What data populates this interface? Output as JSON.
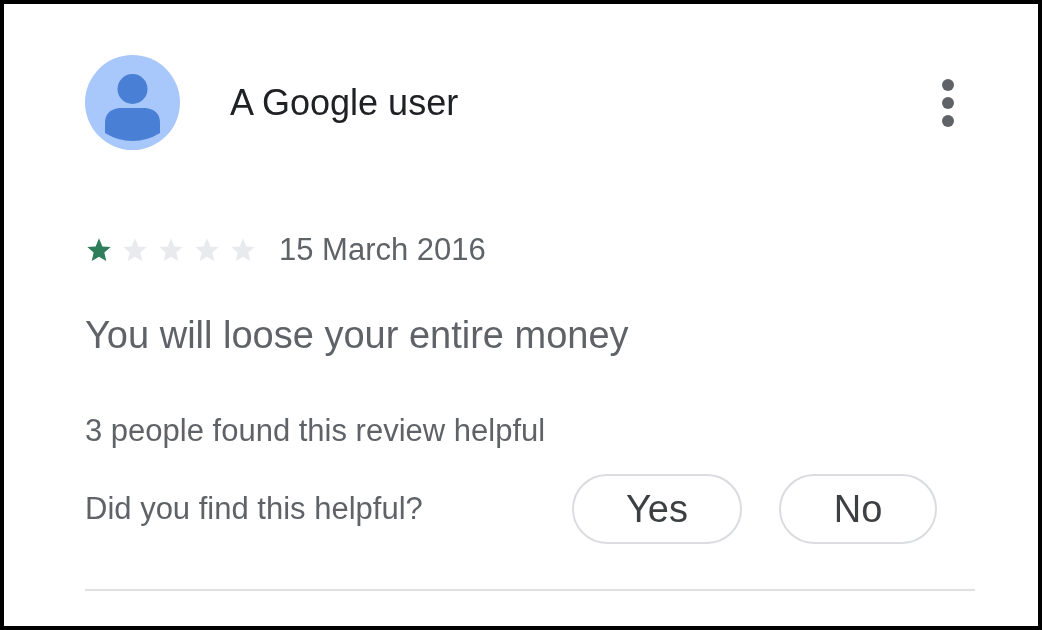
{
  "review": {
    "author": "A Google user",
    "stars": 1,
    "date": "15 March 2016",
    "text": "You will loose your entire money",
    "helpful_count": "3 people found this review helpful",
    "helpful_prompt": "Did you find this helpful?",
    "buttons": [
      "Yes",
      "No"
    ]
  }
}
